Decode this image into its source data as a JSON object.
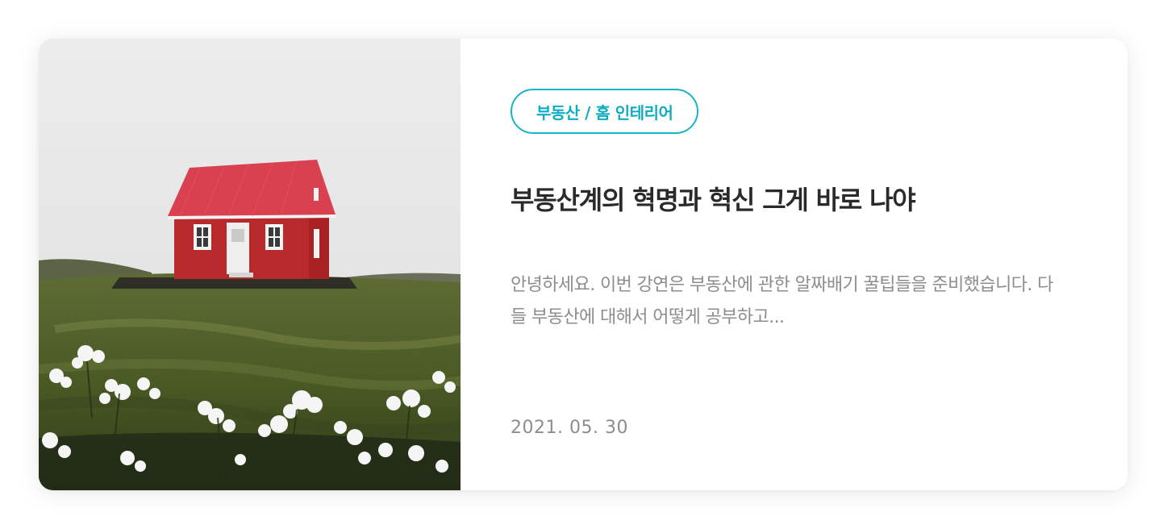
{
  "card": {
    "image_alt": "Red house on a green hill with white flowers",
    "category": "부동산 / 홈 인테리어",
    "title": "부동산계의 혁명과 혁신 그게 바로 나야",
    "excerpt": "안녕하세요. 이번 강연은 부동산에 관한 알짜배기 꿀팁들을 준비했습니다. 다들 부동산에 대해서 어떻게 공부하고...",
    "date": "2021. 05. 30"
  },
  "colors": {
    "accent": "#19b4c6",
    "title": "#2a2a2a",
    "muted": "#8d8d8d",
    "house_red": "#b7292a",
    "roof_red": "#d94150"
  }
}
